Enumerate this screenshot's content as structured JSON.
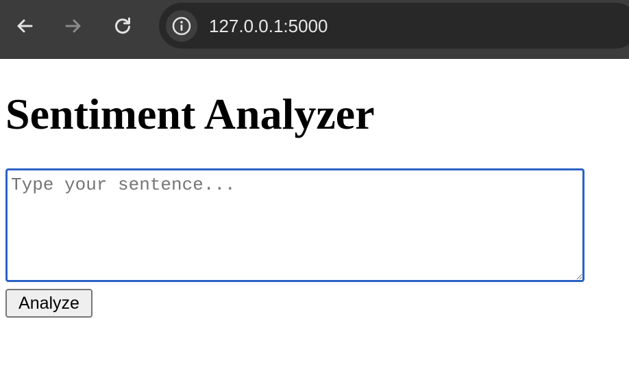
{
  "browser": {
    "url": "127.0.0.1:5000",
    "icons": {
      "back": "back-arrow-icon",
      "forward": "forward-arrow-icon",
      "reload": "reload-icon",
      "site_info": "info-icon"
    },
    "colors": {
      "toolbar_bg": "#3c3c3c",
      "omnibox_bg": "#282828",
      "url_text": "#e8e8e8"
    }
  },
  "page": {
    "title": "Sentiment Analyzer",
    "sentence_input": {
      "placeholder": "Type your sentence...",
      "value": ""
    },
    "analyze_button_label": "Analyze",
    "colors": {
      "focus_ring": "#2a62c4"
    }
  }
}
